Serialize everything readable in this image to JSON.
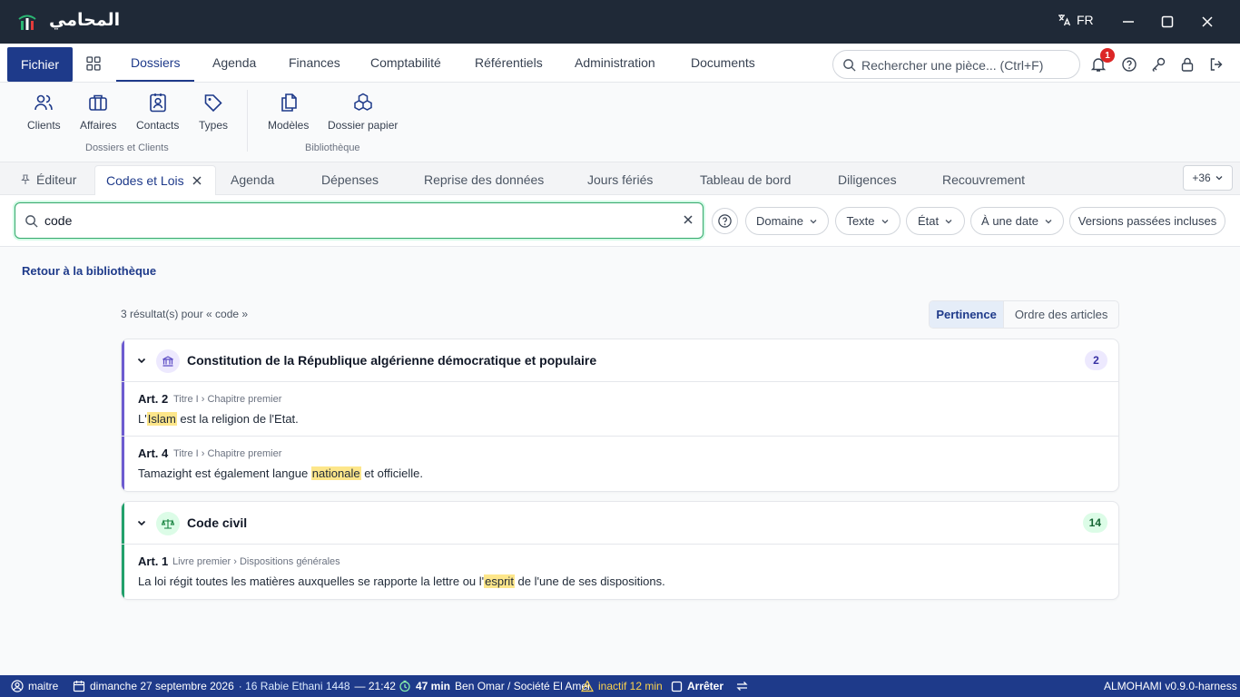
{
  "app": {
    "name": "المحامي",
    "language": "FR"
  },
  "menu": {
    "fichier": "Fichier",
    "items": [
      "Dossiers",
      "Agenda",
      "Finances",
      "Comptabilité",
      "Référentiels",
      "Administration",
      "Documents"
    ],
    "active": "Dossiers",
    "search_placeholder": "Rechercher une pièce... (Ctrl+F)",
    "notifications_count": "1"
  },
  "ribbon": {
    "groups": [
      {
        "label": "Dossiers et Clients",
        "tools": [
          "Clients",
          "Affaires",
          "Contacts",
          "Types"
        ]
      },
      {
        "label": "Bibliothèque",
        "tools": [
          "Modèles",
          "Dossier papier"
        ]
      }
    ]
  },
  "tabs": {
    "items": [
      "Éditeur",
      "Codes et Lois",
      "Agenda",
      "Dépenses",
      "Reprise des données",
      "Jours fériés",
      "Tableau de bord",
      "Diligences",
      "Recouvrement"
    ],
    "active": "Codes et Lois",
    "more": "+36"
  },
  "filters": {
    "query": "code",
    "chips": [
      "Domaine",
      "Texte",
      "État",
      "À une date",
      "Versions passées incluses"
    ]
  },
  "content": {
    "back": "Retour à la bibliothèque",
    "results": "3 résultat(s) pour « code »",
    "sort": {
      "options": [
        "Pertinence",
        "Ordre des articles"
      ],
      "selected": "Pertinence"
    },
    "groups": [
      {
        "title": "Constitution de la République algérienne démocratique et populaire",
        "count": "2",
        "icon": "institution-icon",
        "accent": "#6d5bd0",
        "articles": [
          {
            "num": "Art. 2",
            "path": "Titre I › Chapitre premier",
            "before": "L'",
            "highlight": "Islam",
            "after": " est la religion de l'Etat."
          },
          {
            "num": "Art. 4",
            "path": "Titre I › Chapitre premier",
            "before": "Tamazight est également langue ",
            "highlight": "nationale",
            "after": " et officielle."
          }
        ]
      },
      {
        "title": "Code civil",
        "count": "14",
        "icon": "scales-icon",
        "accent": "#22a06b",
        "articles": [
          {
            "num": "Art. 1",
            "path": "Livre premier › Dispositions générales",
            "before": "La loi régit toutes les matières auxquelles se rapporte la lettre ou l'",
            "highlight": "esprit",
            "after": " de l'une de ses dispositions."
          }
        ]
      }
    ]
  },
  "status": {
    "user": "maitre",
    "date": "dimanche 27 septembre 2026",
    "hijri": "· 16 Rabie Ethani 1448",
    "time": "— 21:42",
    "timer": "47 min",
    "case": "Ben Omar / Société El Amel",
    "inactive": "inactif 12 min",
    "stop": "Arrêter",
    "version": "ALMOHAMI v0.9.0-harness"
  }
}
